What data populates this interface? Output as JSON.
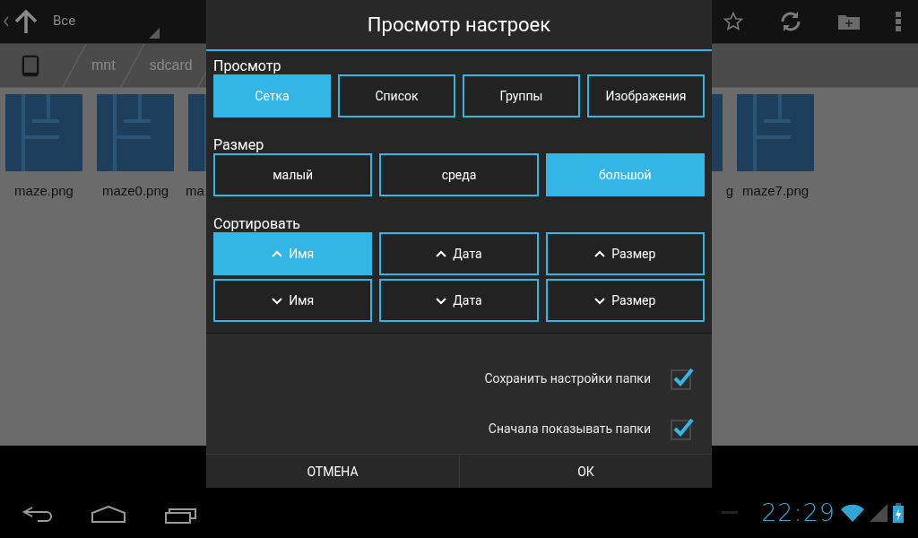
{
  "action_bar": {
    "filter": "Все"
  },
  "breadcrumb": [
    "mnt",
    "sdcard"
  ],
  "files": [
    {
      "name": "maze.png",
      "kind": "whole"
    },
    {
      "name": "maze0.png",
      "kind": "whole"
    },
    {
      "name": "ma",
      "kind": "cut_right"
    },
    {
      "kind": "hidden"
    },
    {
      "kind": "hidden"
    },
    {
      "kind": "hidden"
    },
    {
      "kind": "hidden"
    },
    {
      "name": "g",
      "kind": "cut_left"
    },
    {
      "name": "maze7.png",
      "kind": "whole"
    }
  ],
  "dialog": {
    "title": "Просмотр настроек",
    "sections": [
      {
        "label": "Просмотр",
        "rows": [
          [
            {
              "label": "Сетка",
              "selected": true
            },
            {
              "label": "Список",
              "selected": false
            },
            {
              "label": "Группы",
              "selected": false
            },
            {
              "label": "Изображения",
              "selected": false
            }
          ]
        ]
      },
      {
        "label": "Размер",
        "rows": [
          [
            {
              "label": "малый",
              "selected": false
            },
            {
              "label": "среда",
              "selected": false
            },
            {
              "label": "большой",
              "selected": true
            }
          ]
        ]
      },
      {
        "label": "Сортировать",
        "rows": [
          [
            {
              "label": "Имя",
              "kind": "asc",
              "selected": true
            },
            {
              "label": "Дата",
              "kind": "asc",
              "selected": false
            },
            {
              "label": "Размер",
              "kind": "asc",
              "selected": false
            }
          ],
          [
            {
              "label": "Имя",
              "kind": "desc",
              "selected": false
            },
            {
              "label": "Дата",
              "kind": "desc",
              "selected": false
            },
            {
              "label": "Размер",
              "kind": "desc",
              "selected": false
            }
          ]
        ]
      }
    ],
    "options": [
      {
        "label": "Сохранить настройки папки",
        "checked": true
      },
      {
        "label": "Сначала показывать папки",
        "checked": true
      }
    ],
    "buttons": [
      "ОТМЕНА",
      "ОК"
    ]
  },
  "status_bar": {
    "time": "22:29"
  }
}
